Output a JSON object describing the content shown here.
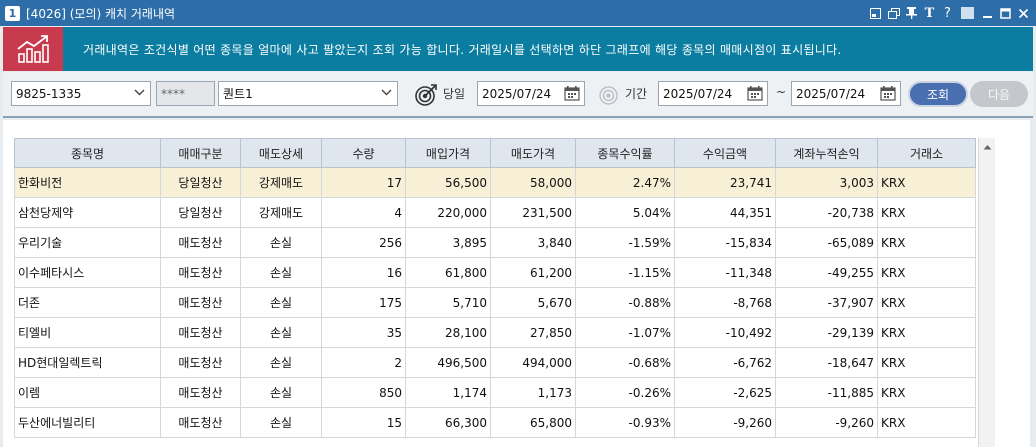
{
  "window": {
    "number": "1",
    "title": "[4026] (모의) 캐치 거래내역"
  },
  "banner": {
    "text": "거래내역은 조건식별 어떤 종목을 얼마에 사고 팔았는지 조회 가능 합니다. 거래일시를 선택하면 하단 그래프에 해당 종목의 매매시점이 표시됩니다."
  },
  "toolbar": {
    "account": "9825-1335",
    "password_mask": "****",
    "strategy": "퀀트1",
    "day_label": "당일",
    "day_date": "2025/07/24",
    "period_label": "기간",
    "period_from": "2025/07/24",
    "period_sep": "~",
    "period_to": "2025/07/24",
    "search_label": "조회",
    "next_label": "다음"
  },
  "table": {
    "columns": [
      "종목명",
      "매매구분",
      "매도상세",
      "수량",
      "매입가격",
      "매도가격",
      "종목수익률",
      "수익금액",
      "계좌누적손익",
      "거래소"
    ],
    "rows": [
      [
        "한화비전",
        "당일청산",
        "강제매도",
        "17",
        "56,500",
        "58,000",
        "2.47%",
        "23,741",
        "3,003",
        "KRX"
      ],
      [
        "삼천당제약",
        "당일청산",
        "강제매도",
        "4",
        "220,000",
        "231,500",
        "5.04%",
        "44,351",
        "-20,738",
        "KRX"
      ],
      [
        "우리기술",
        "매도청산",
        "손실",
        "256",
        "3,895",
        "3,840",
        "-1.59%",
        "-15,834",
        "-65,089",
        "KRX"
      ],
      [
        "이수페타시스",
        "매도청산",
        "손실",
        "16",
        "61,800",
        "61,200",
        "-1.15%",
        "-11,348",
        "-49,255",
        "KRX"
      ],
      [
        "더존",
        "매도청산",
        "손실",
        "175",
        "5,710",
        "5,670",
        "-0.88%",
        "-8,768",
        "-37,907",
        "KRX"
      ],
      [
        "티엘비",
        "매도청산",
        "손실",
        "35",
        "28,100",
        "27,850",
        "-1.07%",
        "-10,492",
        "-29,139",
        "KRX"
      ],
      [
        "HD현대일렉트릭",
        "매도청산",
        "손실",
        "2",
        "496,500",
        "494,000",
        "-0.68%",
        "-6,762",
        "-18,647",
        "KRX"
      ],
      [
        "이렘",
        "매도청산",
        "손실",
        "850",
        "1,174",
        "1,173",
        "-0.26%",
        "-2,625",
        "-11,885",
        "KRX"
      ],
      [
        "두산에너빌리티",
        "매도청산",
        "손실",
        "15",
        "66,300",
        "65,800",
        "-0.93%",
        "-9,260",
        "-9,260",
        "KRX"
      ]
    ]
  },
  "colors": {
    "titlebar": "#2d6ea8",
    "banner": "#0a7da0",
    "banner_icon_bg": "#c83a4d",
    "selected_row": "#f8f0d6",
    "search_button": "#4a6fb0"
  }
}
